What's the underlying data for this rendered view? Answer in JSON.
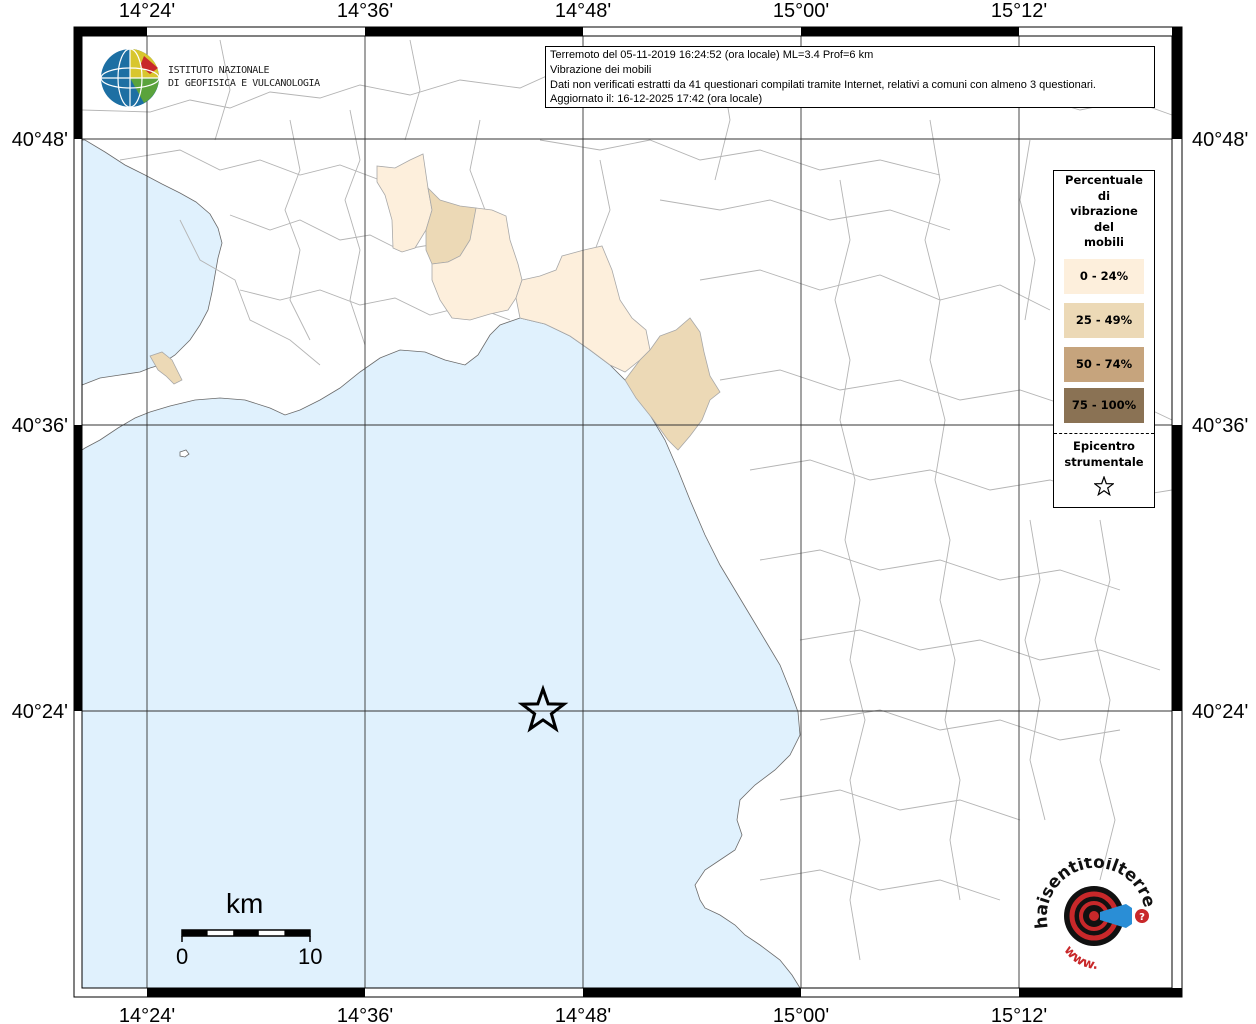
{
  "map": {
    "lon_ticks": [
      "14°24'",
      "14°36'",
      "14°48'",
      "15°00'",
      "15°12'"
    ],
    "lat_ticks": [
      "40°48'",
      "40°36'",
      "40°24'"
    ],
    "colors": {
      "sea": "#e0f1fd",
      "land": "#ffffff",
      "borders": "#b4b4b4",
      "grid": "#333333"
    }
  },
  "info": {
    "line1": "Terremoto del 05-11-2019 16:24:52 (ora locale) ML=3.4 Prof=6 km",
    "line2": "Vibrazione dei mobili",
    "line3": "Dati non verificati estratti da 41 questionari compilati tramite Internet, relativi a comuni con almeno 3 questionari.",
    "line4": "Aggiornato il: 16-12-2025 17:42 (ora locale)"
  },
  "legend": {
    "title": [
      "Percentuale",
      "di",
      "vibrazione",
      "del",
      "mobili"
    ],
    "classes": [
      {
        "label": "0 - 24%",
        "color": "#fdefdc"
      },
      {
        "label": "25 - 49%",
        "color": "#ecd9b6"
      },
      {
        "label": "50 - 74%",
        "color": "#c6a47d"
      },
      {
        "label": "75 - 100%",
        "color": "#8a7254"
      }
    ],
    "epicenter": [
      "Epicentro",
      "strumentale"
    ]
  },
  "logo": {
    "line1": "ISTITUTO NAZIONALE",
    "line2": "DI GEOFISICA E VULCANOLOGIA"
  },
  "scale": {
    "unit": "km",
    "min": "0",
    "max": "10"
  },
  "badge": {
    "top": "haisentitoilterremoto.it",
    "bottom": "www."
  }
}
